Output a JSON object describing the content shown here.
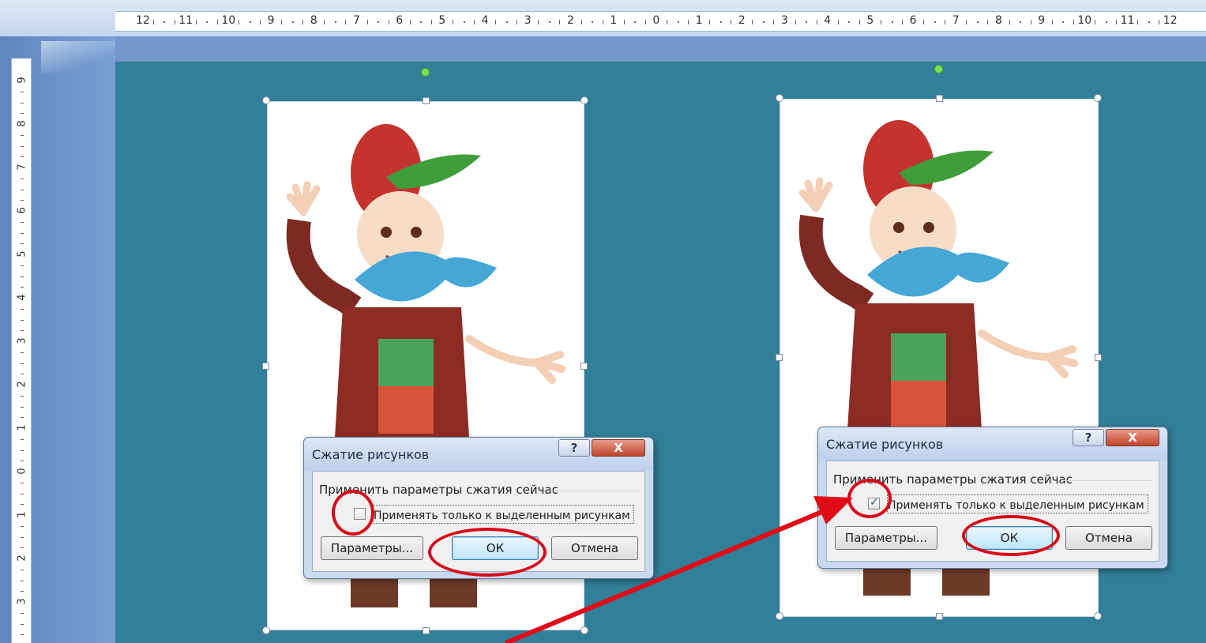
{
  "ruler": {
    "horizontal": [
      "12",
      "11",
      "10",
      "9",
      "8",
      "7",
      "6",
      "5",
      "4",
      "3",
      "2",
      "1",
      "0",
      "1",
      "2",
      "3",
      "4",
      "5",
      "6",
      "7",
      "8",
      "9",
      "10",
      "11",
      "12"
    ],
    "vertical": [
      "9",
      "8",
      "7",
      "6",
      "5",
      "4",
      "3",
      "2",
      "1",
      "0",
      "1",
      "2",
      "3"
    ]
  },
  "dialogs": [
    {
      "title": "Сжатие рисунков",
      "help_label": "?",
      "close_label": "X",
      "group_label": "Применить параметры сжатия сейчас",
      "checkbox_label": "Применять только к выделенным рисункам",
      "checkbox_checked": false,
      "params_button": "Параметры...",
      "ok_button": "ОК",
      "cancel_button": "Отмена"
    },
    {
      "title": "Сжатие рисунков",
      "help_label": "?",
      "close_label": "X",
      "group_label": "Применить параметры сжатия сейчас",
      "checkbox_label": "Применять только к выделенным рисункам",
      "checkbox_checked": true,
      "params_button": "Параметры...",
      "ok_button": "ОК",
      "cancel_button": "Отмена"
    }
  ],
  "colors": {
    "slide_background": "#317f98",
    "annotation": "#d8091a",
    "selection_handle": "#7be04f"
  }
}
